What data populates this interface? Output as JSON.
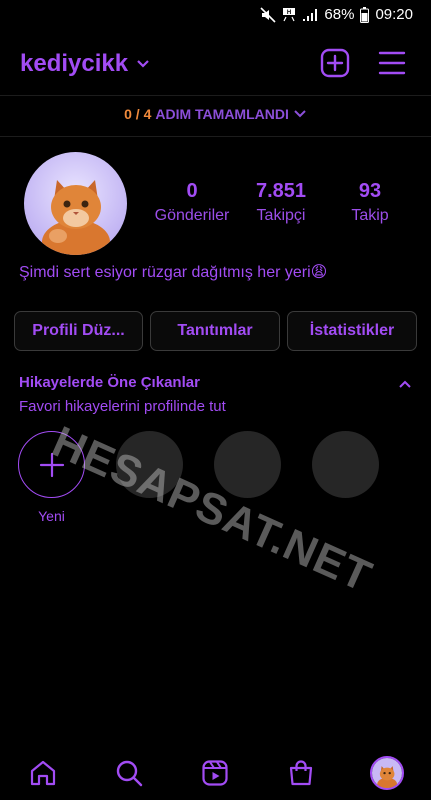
{
  "status_bar": {
    "battery": "68%",
    "time": "09:20"
  },
  "header": {
    "username": "kediycikk"
  },
  "steps": {
    "progress": "0 / 4",
    "label": "ADIM TAMAMLANDI"
  },
  "profile": {
    "stats": [
      {
        "value": "0",
        "label": "Gönderiler"
      },
      {
        "value": "7.851",
        "label": "Takipçi"
      },
      {
        "value": "93",
        "label": "Takip"
      }
    ],
    "bio": "Şimdi sert esiyor rüzgar dağıtmış her yeri😩"
  },
  "buttons": {
    "edit_profile": "Profili Düz...",
    "promotions": "Tanıtımlar",
    "insights": "İstatistikler"
  },
  "highlights": {
    "title": "Hikayelerde Öne Çıkanlar",
    "subtitle": "Favori hikayelerini profilinde tut",
    "new_label": "Yeni"
  },
  "watermark": "HESAPSAT.NET",
  "colors": {
    "accent": "#a24cf4",
    "orange": "#f08a3c",
    "background": "#000000"
  }
}
